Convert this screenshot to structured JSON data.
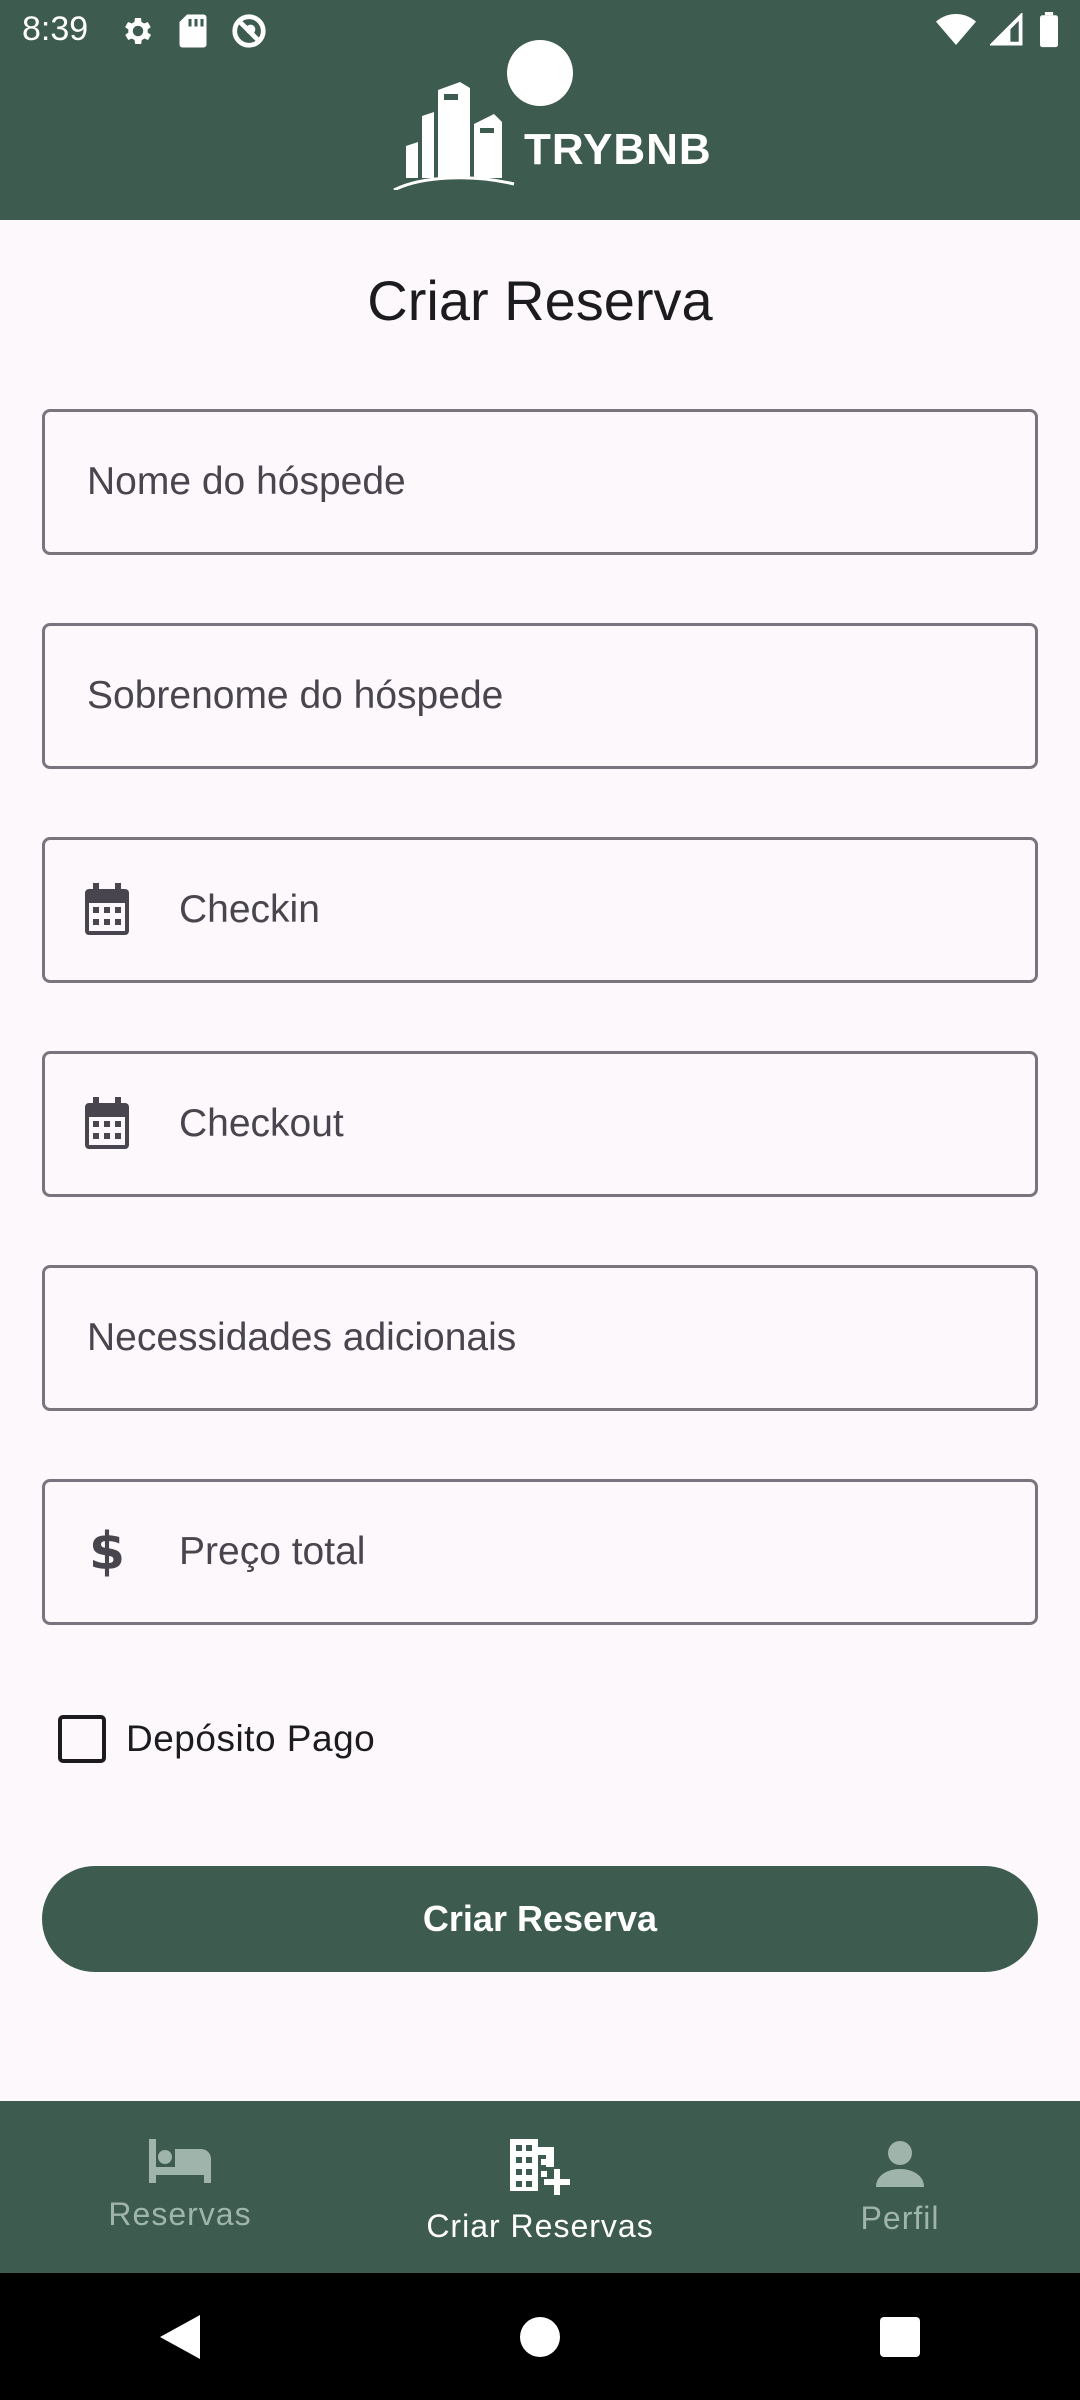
{
  "status_bar": {
    "time": "8:39"
  },
  "header": {
    "brand": "TRYBNB"
  },
  "page": {
    "title": "Criar Reserva"
  },
  "form": {
    "guest_first_name_placeholder": "Nome do hóspede",
    "guest_last_name_placeholder": "Sobrenome do hóspede",
    "checkin_placeholder": "Checkin",
    "checkout_placeholder": "Checkout",
    "additional_needs_placeholder": "Necessidades adicionais",
    "total_price_placeholder": "Preço total",
    "currency_symbol": "$",
    "deposit_label": "Depósito Pago",
    "deposit_checked": false,
    "submit_label": "Criar Reserva"
  },
  "bottom_nav": {
    "items": [
      {
        "label": "Reservas",
        "icon": "bed-icon",
        "active": false
      },
      {
        "label": "Criar Reservas",
        "icon": "add-building-icon",
        "active": true
      },
      {
        "label": "Perfil",
        "icon": "person-icon",
        "active": false
      }
    ]
  },
  "colors": {
    "primary": "#3e5b4f",
    "background": "#fdf8fb",
    "outline": "#79747e",
    "inactive_nav": "#9fb4aa"
  }
}
